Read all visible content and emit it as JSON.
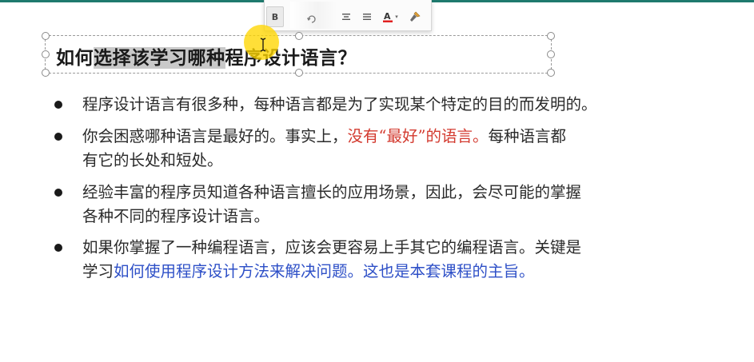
{
  "toolbar": {
    "bold_label": "B",
    "icons": [
      "bold-button",
      "align-center-icon",
      "align-justify-icon",
      "font-color-icon",
      "format-painter-icon"
    ]
  },
  "title": {
    "before": "如何",
    "selected": "选择该学习哪种",
    "after": "程序设计语言？"
  },
  "bullets": {
    "b1": {
      "l1": "程序设计语言有很多种，每种语言都是为了实现某个特定的目的而发明的。"
    },
    "b2": {
      "l1a": "你会困惑哪种语言是最好的。事实上，",
      "l1b": "没有“最好”的语言。",
      "l1c": "每种语言都",
      "l2": "有它的长处和短处。"
    },
    "b3": {
      "l1": "经验丰富的程序员知道各种语言擅长的应用场景，因此，会尽可能的掌握",
      "l2": "各种不同的程序设计语言。"
    },
    "b4": {
      "l1": "如果你掌握了一种编程语言，应该会更容易上手其它的编程语言。关键是",
      "l2a": "学习",
      "l2b": "如何使用程序设计方法来解决问题。这也是本套课程的主旨。"
    }
  },
  "colors": {
    "accent_red": "#d33a2f",
    "accent_blue": "#2d4fc7",
    "cursor_highlight": "#ffd600",
    "top_rule": "#1f7a6e"
  }
}
